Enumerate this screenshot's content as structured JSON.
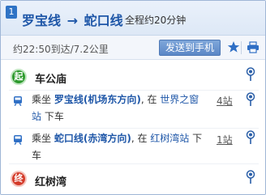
{
  "header": {
    "route_number": "1",
    "from_line": "罗宝线",
    "arrow": "→",
    "to_line": "蛇口线",
    "total_time": "全程约20分钟"
  },
  "summary": {
    "arrival_distance": "约22:50到达/7.2公里",
    "send_button": "发送到手机"
  },
  "steps": {
    "start": {
      "badge": "起",
      "name": "车公庙"
    },
    "ride1": {
      "prefix": "乘坐",
      "line": "罗宝线(机场东方向)",
      "middle": ", 在",
      "station_part1": "世界之窗",
      "station_part2": "站",
      "suffix": "下车",
      "stops": "4站"
    },
    "ride2": {
      "prefix": "乘坐",
      "line": "蛇口线(赤湾方向)",
      "middle": ", 在",
      "station": "红树湾站",
      "suffix": "下车",
      "stops": "1站"
    },
    "end": {
      "badge": "终",
      "name": "红树湾"
    }
  },
  "colors": {
    "accent": "#1f57a8",
    "start_badge": "#2e9a2e",
    "end_badge": "#d43b2a",
    "button": "#5b87c6"
  },
  "icons": [
    "bus-icon",
    "pin-icon",
    "star-icon",
    "print-icon"
  ]
}
